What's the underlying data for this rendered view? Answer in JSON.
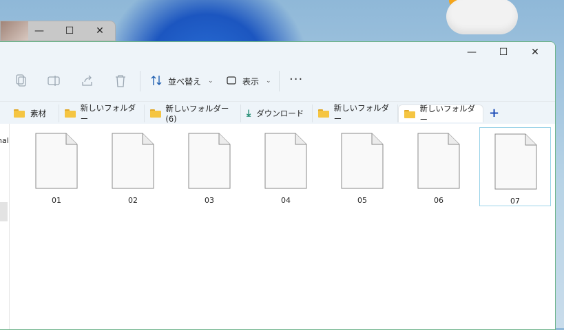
{
  "back_window": {
    "minimize": "—",
    "maximize": "☐",
    "close": "✕"
  },
  "window": {
    "minimize": "—",
    "maximize": "☐",
    "close": "✕"
  },
  "toolbar": {
    "sort_label": "並べ替え",
    "view_label": "表示",
    "more_label": "···",
    "chevron": "⌄"
  },
  "tabs": [
    {
      "label": "素材",
      "icon": "folder"
    },
    {
      "label": "新しいフォルダー",
      "icon": "folder"
    },
    {
      "label": "新しいフォルダー (6)",
      "icon": "folder"
    },
    {
      "label": "ダウンロード",
      "icon": "download"
    },
    {
      "label": "新しいフォルダー",
      "icon": "folder"
    },
    {
      "label": "新しいフォルダー",
      "icon": "folder",
      "active": true
    }
  ],
  "new_tab": "+",
  "nav_pane": {
    "partial_text": "nal"
  },
  "files": [
    {
      "name": "01"
    },
    {
      "name": "02"
    },
    {
      "name": "03"
    },
    {
      "name": "04"
    },
    {
      "name": "05"
    },
    {
      "name": "06"
    },
    {
      "name": "07",
      "selected": true
    }
  ],
  "colors": {
    "accent": "#1e4db7",
    "folder": "#f5c542",
    "download": "#1c8a70",
    "selection_border": "#9bd3e8"
  }
}
